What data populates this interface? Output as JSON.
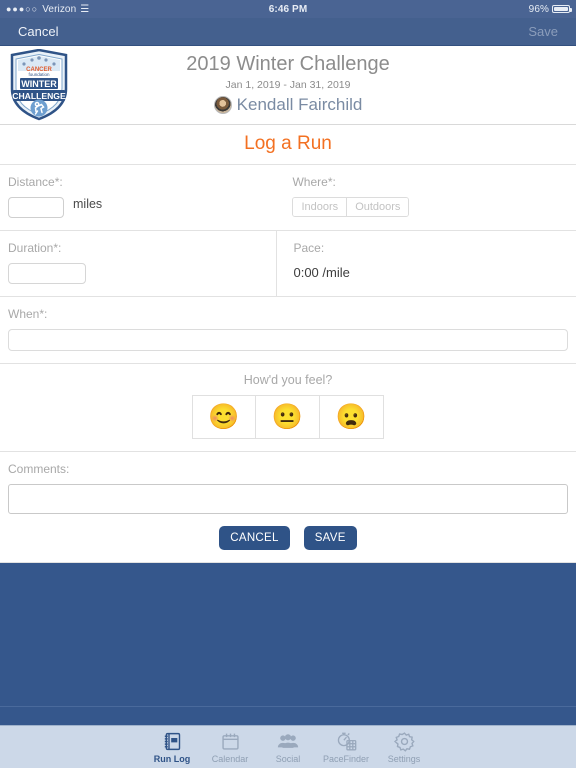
{
  "statusbar": {
    "carrier": "Verizon",
    "signal_dots": "●●●○○",
    "wifi_icon": "wifi-icon",
    "time": "6:46 PM",
    "battery_percent": "96%"
  },
  "navbar": {
    "cancel_label": "Cancel",
    "save_label": "Save",
    "background_color": "#44608e"
  },
  "challenge": {
    "logo_icon": "winter-challenge-shield-logo",
    "logo_text_top": "WINTER",
    "logo_text_bottom": "CHALLENGE",
    "title": "2019 Winter Challenge",
    "dates": "Jan 1, 2019 - Jan 31, 2019",
    "user_name": "Kendall Fairchild",
    "avatar_icon": "user-avatar"
  },
  "form": {
    "title": "Log a Run",
    "title_color": "#f37021",
    "distance": {
      "label": "Distance*:",
      "value": "",
      "unit": "miles"
    },
    "where": {
      "label": "Where*:",
      "options": [
        "Indoors",
        "Outdoors"
      ],
      "selected": ""
    },
    "duration": {
      "label": "Duration*:",
      "value": ""
    },
    "pace": {
      "label": "Pace:",
      "value": "0:00 /mile"
    },
    "when": {
      "label": "When*:",
      "value": ""
    },
    "feel": {
      "question": "How'd you feel?",
      "options": [
        {
          "name": "feel-happy",
          "emoji": "😊"
        },
        {
          "name": "feel-neutral",
          "emoji": "😐"
        },
        {
          "name": "feel-sad",
          "emoji": "😦"
        }
      ]
    },
    "comments": {
      "label": "Comments:",
      "value": ""
    },
    "cancel_button": "CANCEL",
    "save_button": "SAVE",
    "button_color": "#2f5387"
  },
  "tabbar": {
    "background_color": "#ccd8e8",
    "active_color": "#2f5387",
    "inactive_color": "#8f9fb3",
    "items": [
      {
        "label": "Run Log",
        "icon": "notebook-icon",
        "active": true
      },
      {
        "label": "Calendar",
        "icon": "calendar-icon",
        "active": false
      },
      {
        "label": "Social",
        "icon": "people-icon",
        "active": false
      },
      {
        "label": "PaceFinder",
        "icon": "stopwatch-calculator-icon",
        "active": false
      },
      {
        "label": "Settings",
        "icon": "gear-icon",
        "active": false
      }
    ]
  }
}
